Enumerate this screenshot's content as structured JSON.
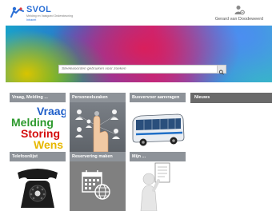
{
  "header": {
    "logo_title": "SVOL",
    "logo_subtitle": "Melding en Vastgoed Ondersteuning",
    "logo_tagline": "Intranet",
    "user_name": "Gerard van Doodeweerd"
  },
  "search": {
    "placeholder": "Steekwoorden gebruiken voor zoeken"
  },
  "tiles": [
    {
      "label": "Vraag, Melding ..."
    },
    {
      "label": "Personeelszaken"
    },
    {
      "label": "Busvervoer aanvragen"
    },
    {
      "label": "Telefoonlijst"
    },
    {
      "label": "Reservering maken"
    },
    {
      "label": "Mijn ..."
    }
  ],
  "vm_words": [
    "Vraag",
    "Melding",
    "Storing",
    "Wens"
  ],
  "nieuws": {
    "label": "Nieuws"
  },
  "colors": {
    "tile_header": "#8e9399",
    "nieuws_header": "#6a6a6a",
    "brand_blue": "#2a6fd6",
    "word_vraag": "#1f5ec9",
    "word_melding": "#2e9a2e",
    "word_storing": "#d40f0f",
    "word_wens": "#e7b800"
  }
}
